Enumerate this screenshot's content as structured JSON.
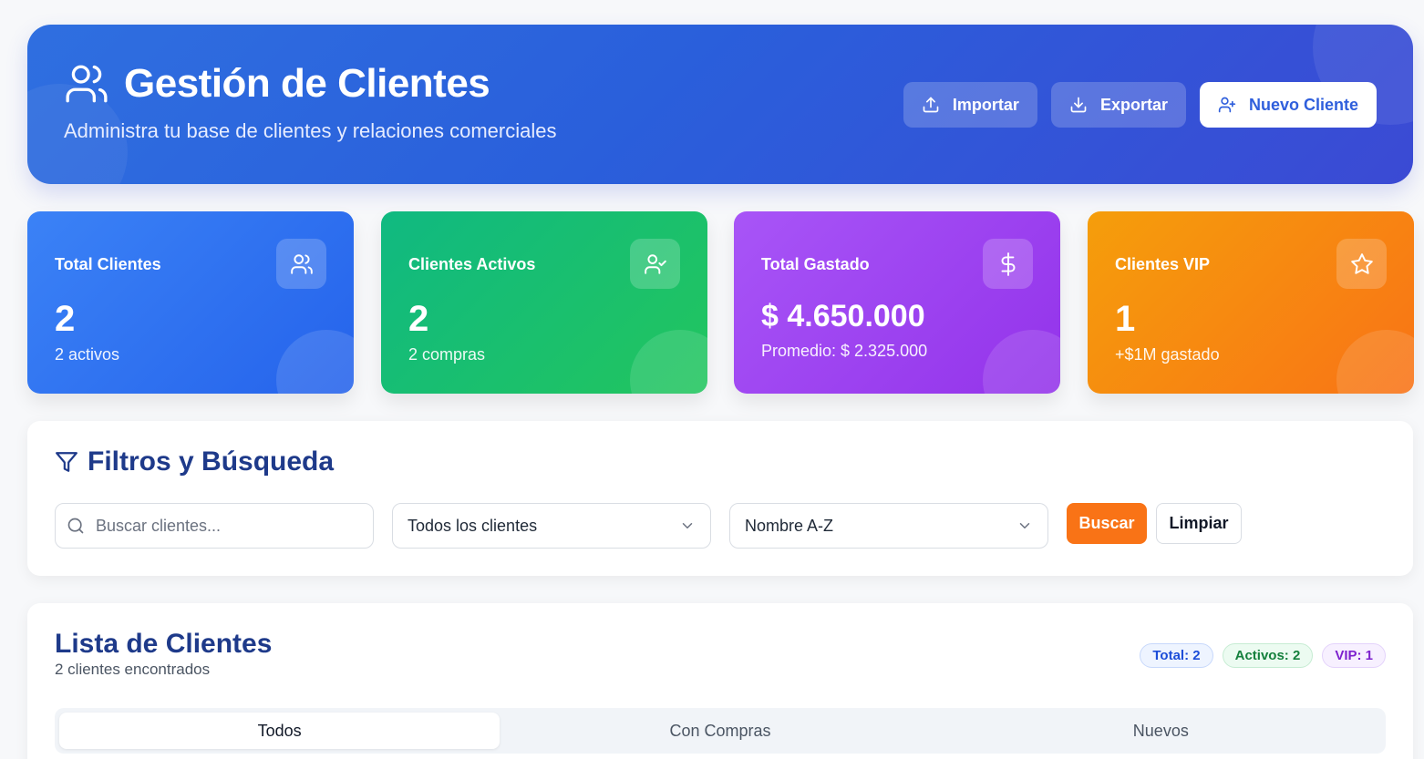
{
  "header": {
    "title": "Gestión de Clientes",
    "subtitle": "Administra tu base de clientes y relaciones comerciales",
    "import_label": "Importar",
    "export_label": "Exportar",
    "new_client_label": "Nuevo Cliente"
  },
  "stats": [
    {
      "label": "Total Clientes",
      "value": "2",
      "note": "2 activos",
      "icon": "users-icon"
    },
    {
      "label": "Clientes Activos",
      "value": "2",
      "note": "2 compras",
      "icon": "user-check-icon"
    },
    {
      "label": "Total Gastado",
      "value": "$ 4.650.000",
      "note": "Promedio: $ 2.325.000",
      "icon": "dollar-icon"
    },
    {
      "label": "Clientes VIP",
      "value": "1",
      "note": "+$1M gastado",
      "icon": "star-icon"
    }
  ],
  "filters": {
    "title": "Filtros y Búsqueda",
    "search_placeholder": "Buscar clientes...",
    "status_select": "Todos los clientes",
    "sort_select": "Nombre A-Z",
    "search_button": "Buscar",
    "clear_button": "Limpiar"
  },
  "list": {
    "title": "Lista de Clientes",
    "count": "2 clientes encontrados",
    "badges": {
      "total": "Total: 2",
      "active": "Activos: 2",
      "vip": "VIP: 1"
    },
    "tabs": [
      {
        "label": "Todos",
        "active": true
      },
      {
        "label": "Con Compras",
        "active": false
      },
      {
        "label": "Nuevos",
        "active": false
      }
    ]
  },
  "colors": {
    "hero_gradient": [
      "#2f6fe0",
      "#3b4ad4"
    ],
    "accent_orange": "#f97316",
    "title_blue": "#1e3a8a"
  }
}
